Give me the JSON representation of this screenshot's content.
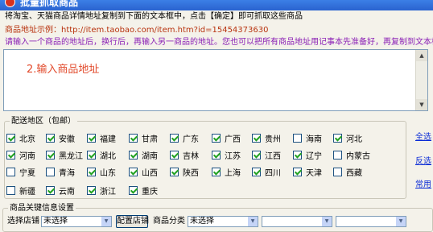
{
  "window": {
    "title": "批量抓取商品"
  },
  "instructions": {
    "line1": "将淘宝、天猫商品详情地址复制到下面的文本框中，点击【确定】即可抓取这些商品",
    "line2": "商品地址示例：http://item.taobao.com/item.htm?id=15454373630",
    "line3": "请输入一个商品的地址后，换行后，再输入另一商品的地址。您也可以把所有商品地址用记事本先准备好，再复制到文本框中"
  },
  "url_input": {
    "placeholder": "2.输入商品地址"
  },
  "region_group": {
    "title": "配送地区（包邮）",
    "provinces": [
      {
        "name": "北京",
        "checked": true
      },
      {
        "name": "安徽",
        "checked": true
      },
      {
        "name": "福建",
        "checked": true
      },
      {
        "name": "甘肃",
        "checked": true
      },
      {
        "name": "广东",
        "checked": true
      },
      {
        "name": "广西",
        "checked": true
      },
      {
        "name": "贵州",
        "checked": true
      },
      {
        "name": "海南",
        "checked": false
      },
      {
        "name": "河北",
        "checked": true
      },
      {
        "name": "河南",
        "checked": true
      },
      {
        "name": "黑龙江",
        "checked": true
      },
      {
        "name": "湖北",
        "checked": true
      },
      {
        "name": "湖南",
        "checked": true
      },
      {
        "name": "吉林",
        "checked": true
      },
      {
        "name": "江苏",
        "checked": true
      },
      {
        "name": "江西",
        "checked": true
      },
      {
        "name": "辽宁",
        "checked": true
      },
      {
        "name": "内蒙古",
        "checked": false
      },
      {
        "name": "宁夏",
        "checked": false
      },
      {
        "name": "青海",
        "checked": false
      },
      {
        "name": "山东",
        "checked": true
      },
      {
        "name": "山西",
        "checked": true
      },
      {
        "name": "陕西",
        "checked": true
      },
      {
        "name": "上海",
        "checked": true
      },
      {
        "name": "四川",
        "checked": true
      },
      {
        "name": "天津",
        "checked": true
      },
      {
        "name": "西藏",
        "checked": false
      },
      {
        "name": "新疆",
        "checked": false
      },
      {
        "name": "云南",
        "checked": true
      },
      {
        "name": "浙江",
        "checked": true
      },
      {
        "name": "重庆",
        "checked": true
      }
    ],
    "links": {
      "select_all": "全选",
      "invert": "反选",
      "common": "常用"
    }
  },
  "keyinfo_group": {
    "title": "商品关键信息设置",
    "shop_label": "选择店铺",
    "shop_value": "未选择",
    "config_button": "配置店铺",
    "category_label": "商品分类",
    "category_value": "未选择",
    "select3_value": "",
    "select4_value": ""
  },
  "colors": {
    "title_bar": "#2a63cf",
    "example_text": "#b8330f",
    "hint_text": "#8a1fb5",
    "placeholder_text": "#e24a2b",
    "link": "#0a2bd6",
    "check": "#21a121"
  }
}
